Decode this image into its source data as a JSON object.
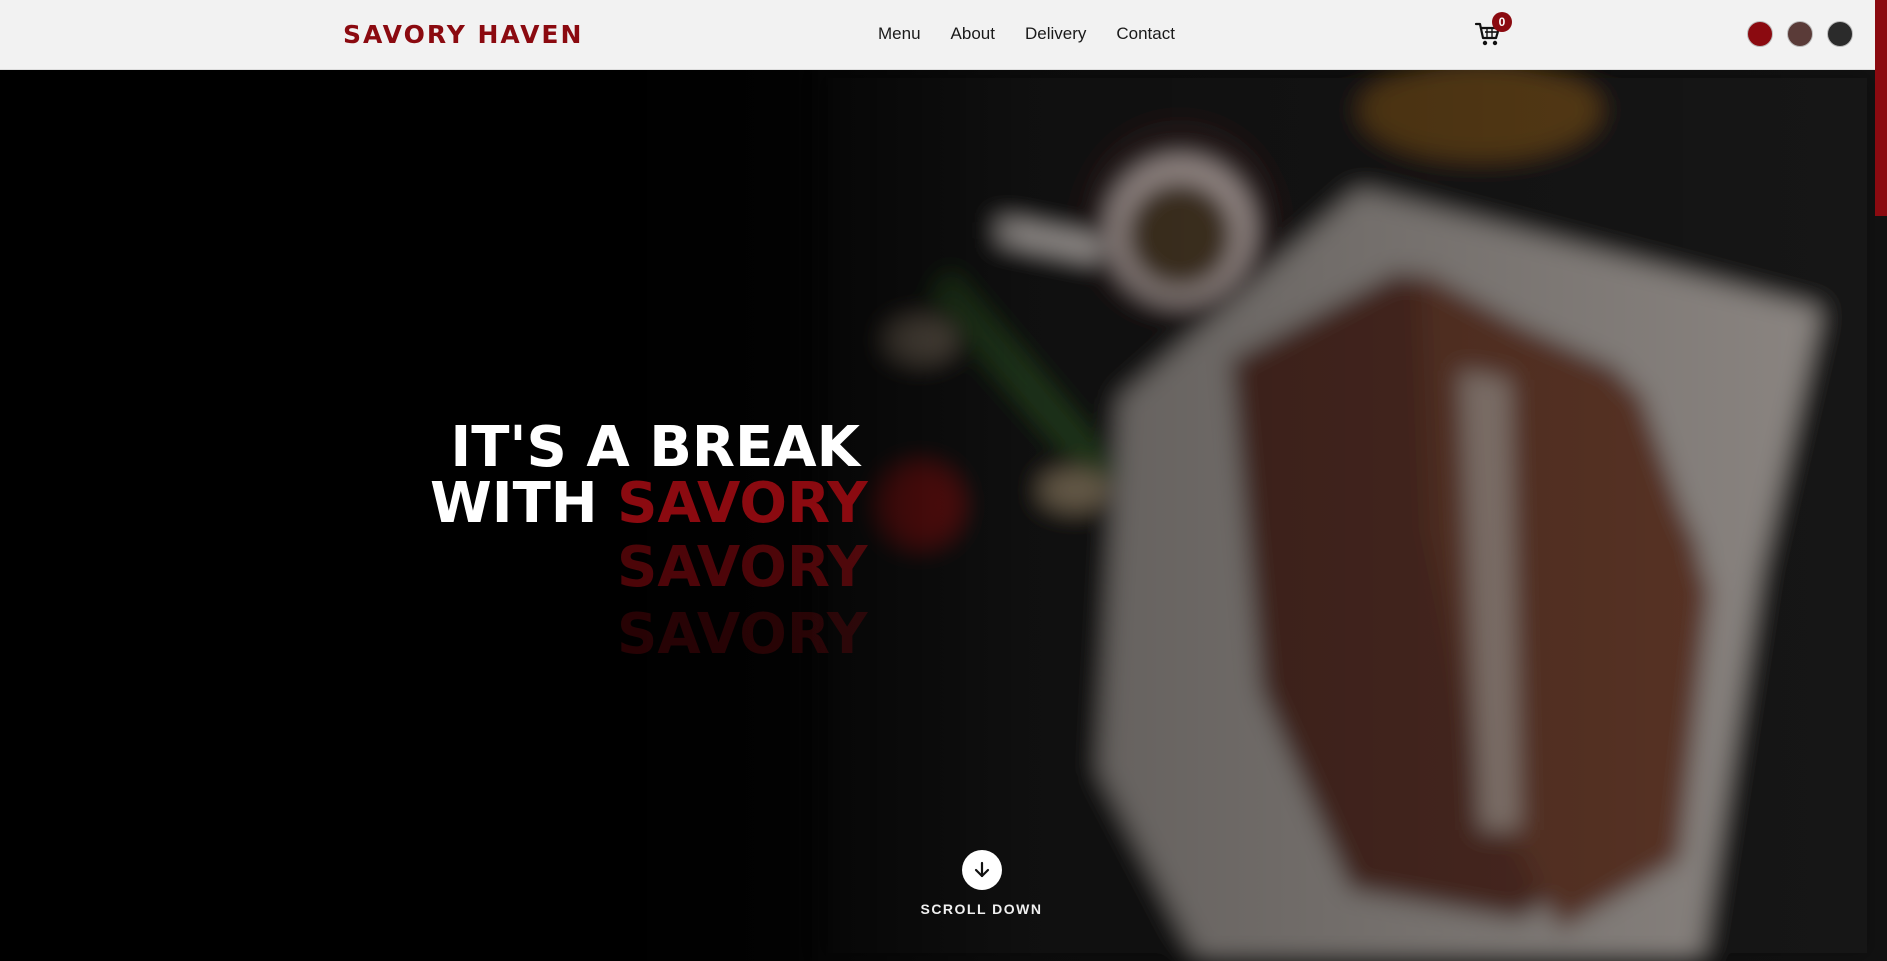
{
  "brand": {
    "name": "SAVORY HAVEN"
  },
  "nav": {
    "links": [
      {
        "label": "Menu"
      },
      {
        "label": "About"
      },
      {
        "label": "Delivery"
      },
      {
        "label": "Contact"
      }
    ]
  },
  "cart": {
    "count": "0",
    "icon": "cart-icon"
  },
  "themes": {
    "colors": [
      "#8b0a10",
      "#5a3b38",
      "#2b2b2b"
    ]
  },
  "hero": {
    "headline_line1": "IT'S A BREAK",
    "headline_line2_prefix": "WITH",
    "headline_accent": "SAVORY",
    "echo_1": "SAVORY",
    "echo_2": "SAVORY",
    "scroll_label": "SCROLL DOWN",
    "scroll_icon": "arrow-down-icon",
    "accent_color": "#8b0a10"
  }
}
